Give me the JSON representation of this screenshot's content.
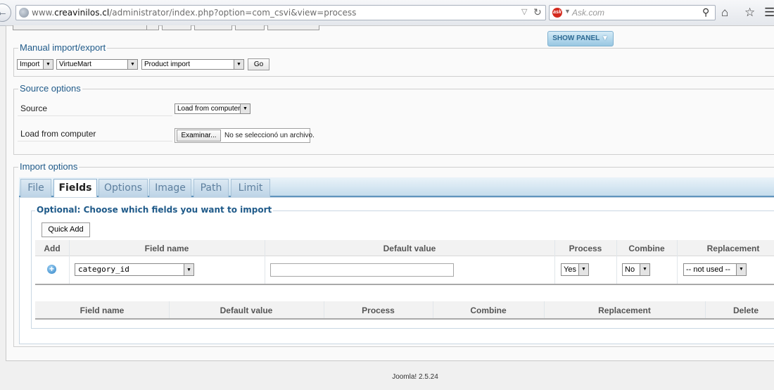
{
  "browser": {
    "url_prefix": "www.",
    "url_host": "creavinilos.cl",
    "url_path": "/administrator/index.php?option=com_csvi&view=process",
    "search_placeholder": "Ask.com",
    "search_engine_logo": "ask"
  },
  "toolbar": {
    "show_panel_label": "SHOW PANEL"
  },
  "manual_import_export": {
    "legend": "Manual import/export",
    "action_value": "Import",
    "component_value": "VirtueMart",
    "template_value": "Product import",
    "go_label": "Go"
  },
  "source_options": {
    "legend": "Source options",
    "source_label": "Source",
    "source_value": "Load from computer",
    "load_label": "Load from computer",
    "browse_label": "Examinar...",
    "no_file_text": "No se seleccionó un archivo."
  },
  "import_options": {
    "legend": "Import options",
    "tabs": [
      "File",
      "Fields",
      "Options",
      "Image",
      "Path",
      "Limit"
    ],
    "active_tab": "Fields"
  },
  "fields_panel": {
    "legend": "Optional: Choose which fields you want to import",
    "quick_add_label": "Quick Add",
    "add_table": {
      "headers": [
        "Add",
        "Field name",
        "Default value",
        "Process",
        "Combine",
        "Replacement"
      ],
      "row": {
        "field_value": "category_id",
        "default_value": "",
        "process_value": "Yes",
        "combine_value": "No",
        "replacement_value": "-- not used --"
      }
    },
    "list_table": {
      "headers": [
        "Field name",
        "Default value",
        "Process",
        "Combine",
        "Replacement",
        "Delete"
      ]
    }
  },
  "footer": {
    "version": "Joomla! 2.5.24"
  },
  "colors": {
    "legend": "#1f5a89",
    "tab_border": "#5f94bd",
    "show_panel": "#98c7e2"
  }
}
